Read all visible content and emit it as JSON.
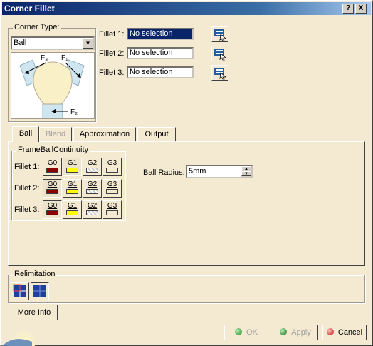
{
  "window": {
    "title": "Corner Fillet",
    "help_label": "?",
    "close_label": "X"
  },
  "corner_type": {
    "legend": "Corner Type:",
    "selected": "Ball",
    "diagram_labels": {
      "f1": "F₁",
      "f2": "F₂",
      "f3": "F₃"
    }
  },
  "fillets": [
    {
      "label": "Fillet 1:",
      "value": "No selection",
      "active": true
    },
    {
      "label": "Fillet 2:",
      "value": "No selection",
      "active": false
    },
    {
      "label": "Fillet 3:",
      "value": "No selection",
      "active": false
    }
  ],
  "tabs": [
    {
      "label": "Ball",
      "selected": true,
      "enabled": true
    },
    {
      "label": "Blend",
      "selected": false,
      "enabled": false
    },
    {
      "label": "Approximation",
      "selected": false,
      "enabled": true
    },
    {
      "label": "Output",
      "selected": false,
      "enabled": true
    }
  ],
  "frame_ball_continuity": {
    "legend": "FrameBallContinuity",
    "rows": [
      {
        "label": "Fillet 1:",
        "pressed": "G1"
      },
      {
        "label": "Fillet 2:",
        "pressed": "G0"
      },
      {
        "label": "Fillet 3:",
        "pressed": "G0"
      }
    ],
    "buttons": [
      {
        "label": "G0",
        "color": "#8b0000"
      },
      {
        "label": "G1",
        "color": "#ffff00"
      },
      {
        "label": "G2",
        "color": "#dcdcdc"
      },
      {
        "label": "G3",
        "color": "#f4ead2"
      }
    ]
  },
  "ball_radius": {
    "label": "Ball Radius:",
    "value": "5mm"
  },
  "relimitation": {
    "legend": "Relimitation"
  },
  "more_info_label": "More Info",
  "buttons": {
    "ok": {
      "label": "OK",
      "enabled": false,
      "icon": "green-dot-icon"
    },
    "apply": {
      "label": "Apply",
      "enabled": false,
      "icon": "green-dot-icon"
    },
    "cancel": {
      "label": "Cancel",
      "enabled": true,
      "icon": "red-dot-icon"
    }
  }
}
